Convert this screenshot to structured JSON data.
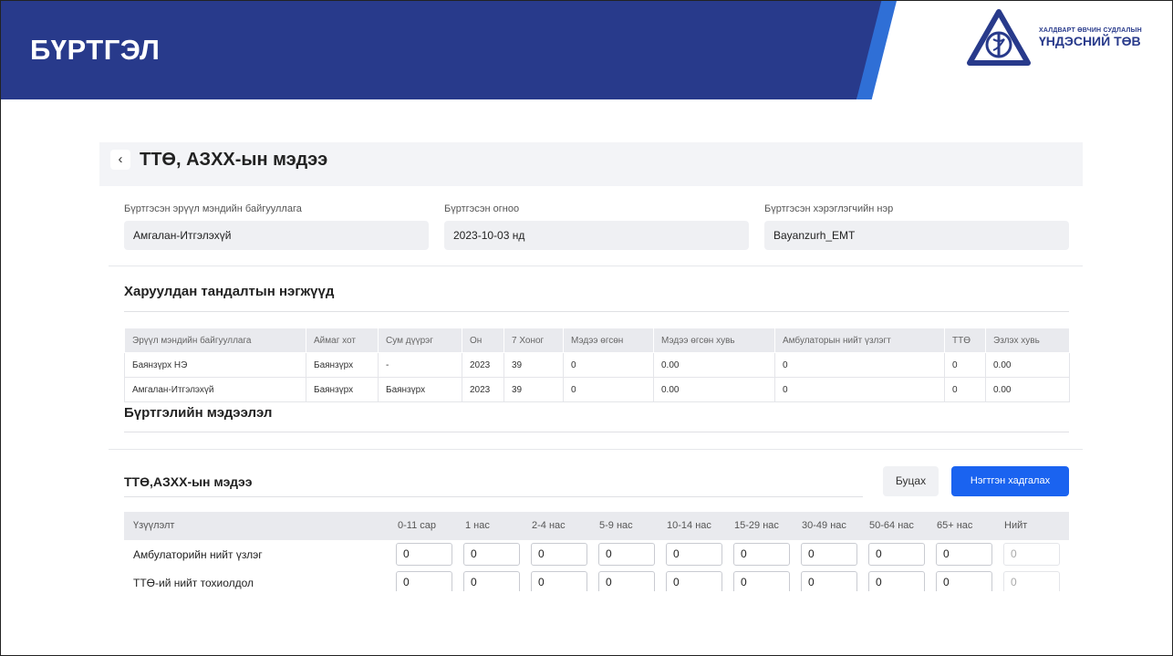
{
  "slide": {
    "title": "БҮРТГЭЛ",
    "logo_line1": "ХАЛДВАРТ ӨВЧИН СУДЛАЛЫН",
    "logo_line2": "ҮНДЭСНИЙ ТӨВ",
    "banner_color": "#283a8b",
    "stripe_color": "#2f6fd6"
  },
  "app": {
    "page_title": "ТТӨ, АЗХХ-ын мэдээ",
    "back_icon": "chevron-left-icon",
    "info": [
      {
        "label": "Бүртгэсэн эрүүл мэндийн байгууллага",
        "value": "Амгалан-Итгэлэхүй"
      },
      {
        "label": "Бүртгэсэн огноо",
        "value": "2023-10-03 нд"
      },
      {
        "label": "Бүртгэсэн хэрэглэгчийн нэр",
        "value": "Bayanzurh_EMT"
      }
    ],
    "sentinel_title": "Харуулдан тандалтын нэгжүүд",
    "sentinel_table": {
      "headers": [
        "Эрүүл мэндийн байгууллага",
        "Аймаг хот",
        "Сум дүүрэг",
        "Он",
        "7 Хоног",
        "Мэдээ өгсөн",
        "Мэдээ өгсөн хувь",
        "Амбулаторын нийт үзлэгт",
        "ТТӨ",
        "Эзлэх хувь"
      ],
      "rows": [
        [
          "Баянзүрх НЭ",
          "Баянзүрх",
          "-",
          "2023",
          "39",
          "0",
          "0.00",
          "0",
          "0",
          "0.00"
        ],
        [
          "Амгалан-Итгэлэхүй",
          "Баянзүрх",
          "Баянзүрх",
          "2023",
          "39",
          "0",
          "0.00",
          "0",
          "0",
          "0.00"
        ]
      ]
    },
    "registration_title": "Бүртгэлийн мэдээлэл",
    "report_title": "ТТӨ,АЗХХ-ын мэдээ",
    "back_button": "Буцах",
    "save_button": "Нэгтгэн хадгалах",
    "accent_color": "#1a63f0",
    "grid": {
      "headers": [
        "Үзүүлэлт",
        "0-11 сар",
        "1 нас",
        "2-4 нас",
        "5-9 нас",
        "10-14 нас",
        "15-29 нас",
        "30-49 нас",
        "50-64 нас",
        "65+ нас",
        "Нийт"
      ],
      "rows": [
        {
          "label": "Амбулаторийн нийт үзлэг",
          "values": [
            "0",
            "0",
            "0",
            "0",
            "0",
            "0",
            "0",
            "0",
            "0"
          ],
          "total": "0"
        },
        {
          "label": "ТТӨ-ий нийт тохиолдол",
          "values": [
            "0",
            "0",
            "0",
            "0",
            "0",
            "0",
            "0",
            "0",
            "0"
          ],
          "total": "0"
        }
      ]
    }
  }
}
